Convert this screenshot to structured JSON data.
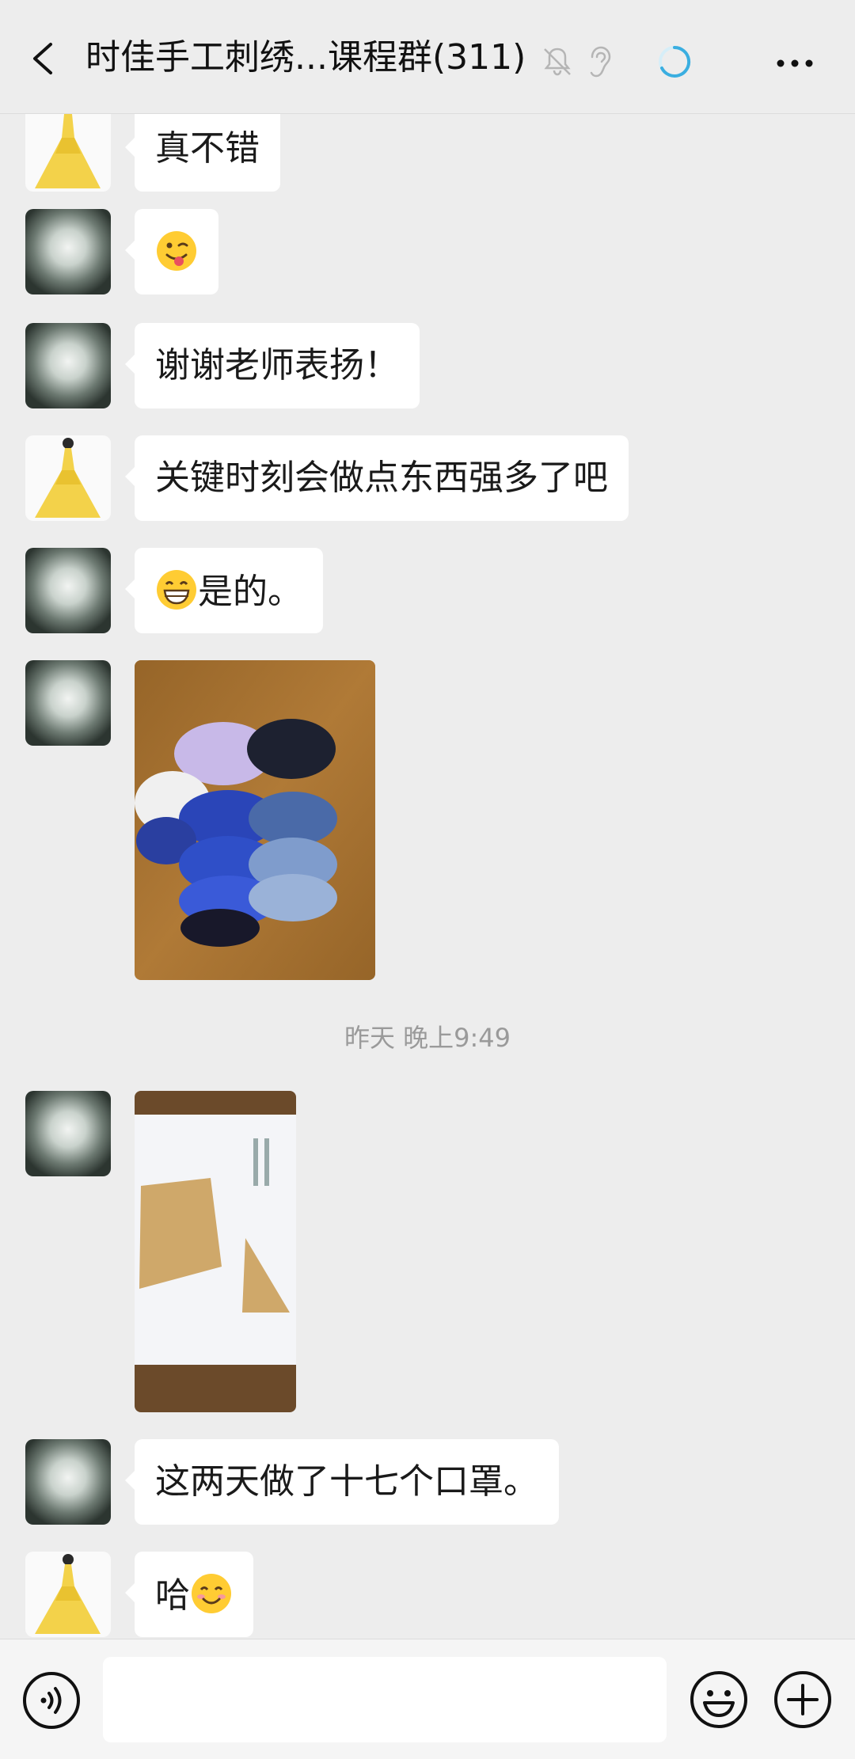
{
  "header": {
    "title": "时佳手工刺绣...课程群(311)",
    "icons": [
      "back-arrow-icon",
      "bell-muted-icon",
      "ear-icon",
      "loading-spinner-icon",
      "more-icon"
    ]
  },
  "messages": [
    {
      "sender": "lady",
      "type": "text",
      "text": "真不错"
    },
    {
      "sender": "flower",
      "type": "emoji",
      "emoji": "winking-tongue-emoji"
    },
    {
      "sender": "flower",
      "type": "text",
      "text": "谢谢老师表扬！"
    },
    {
      "sender": "lady",
      "type": "text",
      "text": "关键时刻会做点东西强多了吧"
    },
    {
      "sender": "flower",
      "type": "text",
      "emoji": "grinning-emoji",
      "text": "是的。"
    },
    {
      "sender": "flower",
      "type": "image",
      "description": "masks-photo"
    },
    {
      "type": "timestamp",
      "text": "昨天 晚上9:49"
    },
    {
      "sender": "flower",
      "type": "image",
      "description": "pattern-photo"
    },
    {
      "sender": "flower",
      "type": "text",
      "text": "这两天做了十七个口罩。"
    },
    {
      "sender": "lady",
      "type": "text",
      "text": "哈",
      "emoji": "smiling-emoji"
    }
  ],
  "input_bar": {
    "placeholder": "",
    "icons": [
      "voice-icon",
      "emoji-icon",
      "plus-icon"
    ]
  },
  "colors": {
    "background": "#ededed",
    "bubble": "#ffffff",
    "spinner": "#3aaee0"
  }
}
